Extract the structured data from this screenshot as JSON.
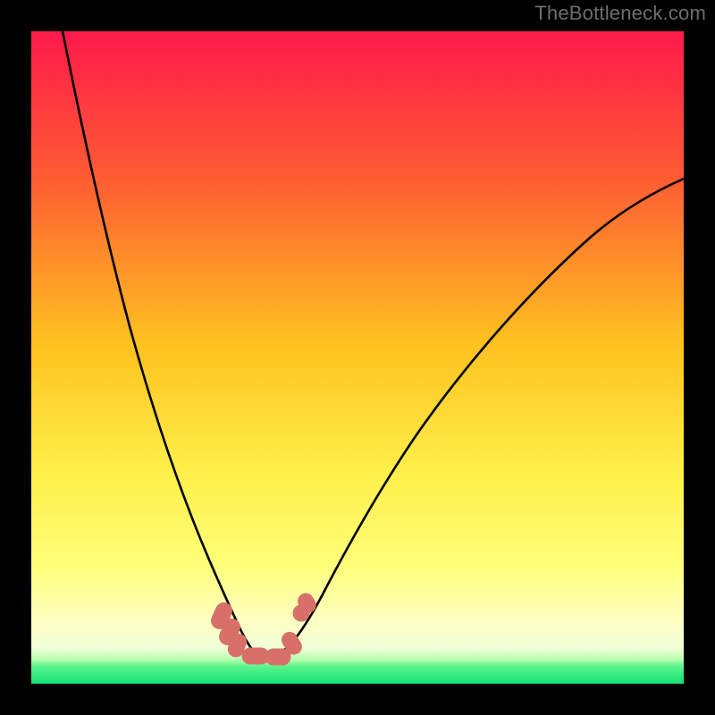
{
  "watermark": "TheBottleneck.com",
  "colors": {
    "page_bg": "#000000",
    "gradient_top": "#ff1a4b",
    "gradient_mid1": "#ff6a2a",
    "gradient_mid2": "#ffd21f",
    "gradient_mid3": "#ffff5a",
    "gradient_band": "#ffffa0",
    "gradient_green": "#13f07a",
    "curve_stroke": "#000000",
    "marker_fill": "#d77069",
    "watermark_text": "#6d6d6d"
  },
  "chart_data": {
    "type": "line",
    "title": "",
    "xlabel": "",
    "ylabel": "",
    "xlim": [
      0,
      100
    ],
    "ylim": [
      0,
      100
    ],
    "note": "Axes unlabeled; values are relative percentages of plot area. Curve is a V-shaped bottleneck profile with minimum near x≈34.",
    "series": [
      {
        "name": "bottleneck-curve",
        "x": [
          4.8,
          8,
          12,
          16,
          20,
          24,
          27,
          29.5,
          31,
          33,
          34,
          35,
          36.7,
          38.6,
          40,
          42,
          46,
          52,
          60,
          70,
          82,
          95,
          100
        ],
        "y": [
          100,
          84,
          66,
          51,
          38,
          26.5,
          18,
          12,
          8.5,
          5.2,
          4.5,
          4.6,
          5.3,
          7.2,
          9.6,
          13.5,
          21,
          31,
          42,
          53.5,
          64.5,
          74,
          77.4
        ]
      }
    ],
    "markers": [
      {
        "name": "left-cluster-1",
        "x": 29.3,
        "y": 10.2
      },
      {
        "name": "left-cluster-2",
        "x": 30.3,
        "y": 8.1
      },
      {
        "name": "left-cluster-3",
        "x": 31.4,
        "y": 6.0
      },
      {
        "name": "bottom-1",
        "x": 33.5,
        "y": 4.3
      },
      {
        "name": "bottom-2",
        "x": 35.5,
        "y": 4.3
      },
      {
        "name": "bottom-3",
        "x": 37.4,
        "y": 4.9
      },
      {
        "name": "right-cluster-1",
        "x": 39.0,
        "y": 6.8
      },
      {
        "name": "right-cluster-2",
        "x": 41.2,
        "y": 11.6
      }
    ],
    "green_band_y": 3.1
  }
}
